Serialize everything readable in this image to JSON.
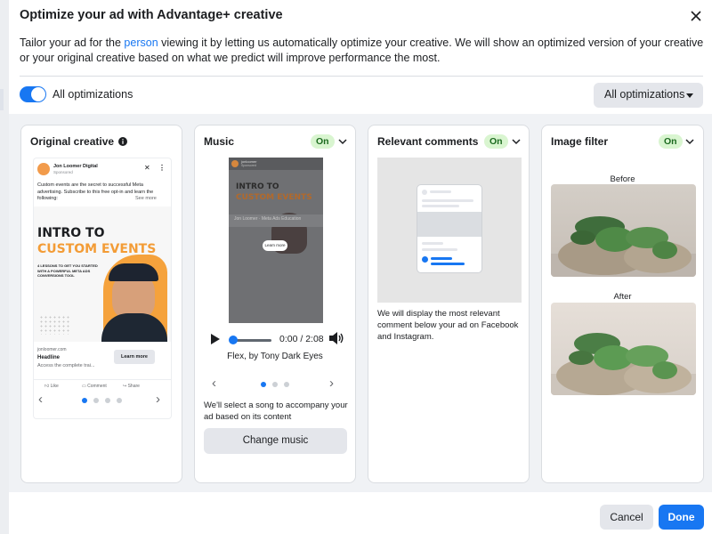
{
  "modal": {
    "title": "Optimize your ad with Advantage+ creative",
    "description_before_link": "Tailor your ad for the ",
    "description_link": "person",
    "description_after_link": " viewing it by letting us automatically optimize your creative. We will show an optimized version of your creative or your original creative based on what we predict will improve performance the most."
  },
  "toggle": {
    "label": "All optimizations",
    "on": true
  },
  "dropdown": {
    "selected": "All optimizations"
  },
  "cards": {
    "original": {
      "title": "Original creative",
      "post": {
        "page_name": "Jon Loomer Digital",
        "sponsored": "Sponsored",
        "text": "Custom events are the secret to successful Meta advertising. Subscribe to this free opt-in and learn the following:",
        "see_more": "See more",
        "headline_1": "INTRO TO",
        "headline_2": "CUSTOM EVENTS",
        "lessons": "4 LESSONS TO GET YOU STARTED WITH A POWERFUL META ADS CONVERSIONS TOOL",
        "site": "jonloomer.com",
        "link_headline": "Headline",
        "link_sub": "Access the complete trai...",
        "cta": "Learn more",
        "like": "Like",
        "comment": "Comment",
        "share": "Share"
      },
      "carousel_active": 0
    },
    "music": {
      "title": "Music",
      "badge": "On",
      "story": {
        "name": "jonloomer",
        "sponsored": "Sponsored",
        "line_1": "INTRO TO",
        "line_2": "CUSTOM EVENTS",
        "band": "Jon Loomer · Meta Ads Education",
        "cta": "Learn more"
      },
      "time": "0:00 / 2:08",
      "song": "Flex, by Tony Dark Eyes",
      "description": "We'll select a song to accompany your ad based on its content",
      "button": "Change music",
      "carousel_active": 0
    },
    "comments": {
      "title": "Relevant comments",
      "badge": "On",
      "description": "We will display the most relevant comment below your ad on Facebook and Instagram."
    },
    "filter": {
      "title": "Image filter",
      "badge": "On",
      "before": "Before",
      "after": "After"
    }
  },
  "footer": {
    "cancel": "Cancel",
    "done": "Done"
  },
  "colors": {
    "accent": "#1877f2",
    "on_badge_bg": "#d9f5d0",
    "on_badge_text": "#1d6b20"
  },
  "icons": [
    "close-icon",
    "info-icon",
    "chevron-down-icon",
    "chevron-left-icon",
    "chevron-right-icon",
    "play-icon",
    "volume-icon",
    "like-icon",
    "comment-icon",
    "share-icon"
  ]
}
